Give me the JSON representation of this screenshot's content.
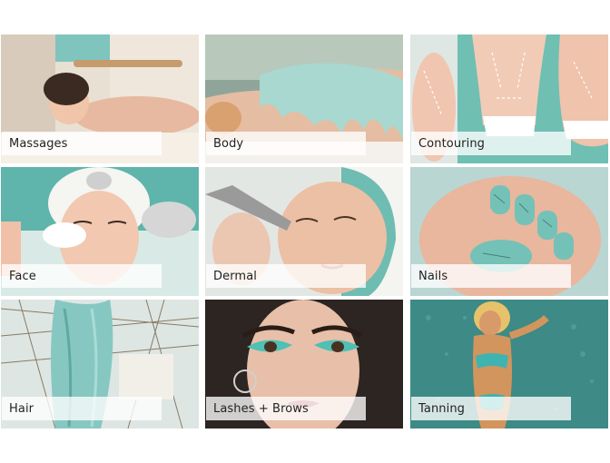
{
  "tiles": [
    {
      "label": "Massages",
      "icon": "massage-photo"
    },
    {
      "label": "Body",
      "icon": "body-wrap-photo"
    },
    {
      "label": "Contouring",
      "icon": "contouring-photo"
    },
    {
      "label": "Face",
      "icon": "facial-photo"
    },
    {
      "label": "Dermal",
      "icon": "dermal-photo"
    },
    {
      "label": "Nails",
      "icon": "nails-photo"
    },
    {
      "label": "Hair",
      "icon": "hair-photo"
    },
    {
      "label": "Lashes + Brows",
      "icon": "lashes-brows-photo"
    },
    {
      "label": "Tanning",
      "icon": "tanning-photo"
    }
  ],
  "colors": {
    "accent_teal": "#7fc4bd",
    "label_background": "#ffffffc7",
    "label_text": "#222222"
  }
}
